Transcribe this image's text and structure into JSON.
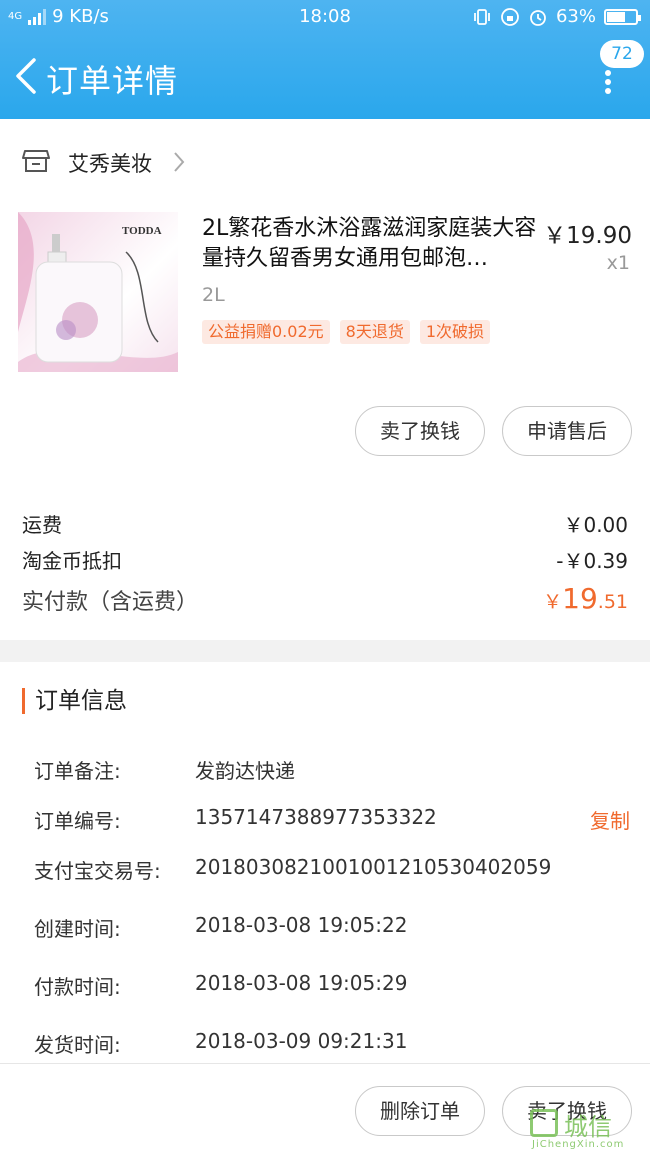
{
  "status_bar": {
    "network": "4G",
    "speed": "9 KB/s",
    "time": "18:08",
    "battery": "63%",
    "battery_level": 0.63
  },
  "header": {
    "title": "订单详情",
    "badge_count": "72"
  },
  "shop": {
    "name": "艾秀美妆"
  },
  "product": {
    "title": "2L繁花香水沐浴露滋润家庭装大容量持久留香男女通用包邮泡…",
    "price": "￥19.90",
    "qty": "x1",
    "spec": "2L",
    "image_brand": "TODDA",
    "tags": [
      "公益捐赠0.02元",
      "8天退货",
      "1次破损"
    ]
  },
  "actions": {
    "sell": "卖了换钱",
    "after_sale": "申请售后"
  },
  "summary": {
    "shipping_label": "运费",
    "shipping_value": "￥0.00",
    "coin_label": "淘金币抵扣",
    "coin_value": "-￥0.39",
    "total_label": "实付款（含运费）",
    "total_symbol": "￥",
    "total_int": "19",
    "total_dec": ".51"
  },
  "order_info": {
    "title": "订单信息",
    "copy": "复制",
    "rows": [
      {
        "label": "订单备注:",
        "value": "发韵达快递"
      },
      {
        "label": "订单编号:",
        "value": "1357147388977353322"
      },
      {
        "label": "支付宝交易号:",
        "value": "2018030821001001210530402059"
      },
      {
        "label": "创建时间:",
        "value": "2018-03-08 19:05:22"
      },
      {
        "label": "付款时间:",
        "value": "2018-03-08 19:05:29"
      },
      {
        "label": "发货时间:",
        "value": "2018-03-09 09:21:31"
      }
    ]
  },
  "bottom": {
    "delete": "删除订单",
    "sell": "卖了换钱"
  },
  "watermark": {
    "text": "城信",
    "sub": "JiChengXin.com"
  },
  "colors": {
    "header": "#2aa7ec",
    "accent": "#f06a2e"
  }
}
